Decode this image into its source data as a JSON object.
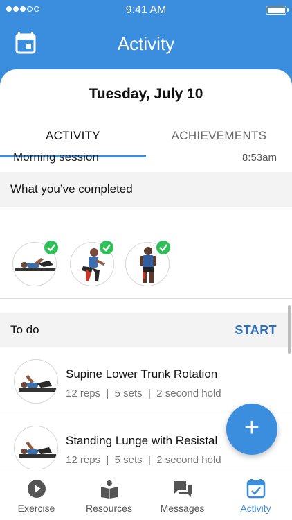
{
  "status_bar": {
    "time": "9:41 AM"
  },
  "header": {
    "title": "Activity",
    "calendar_icon": "calendar-icon"
  },
  "date": "Tuesday, July 10",
  "tabs": [
    {
      "label": "ACTIVITY",
      "active": true
    },
    {
      "label": "ACHIEVEMENTS",
      "active": false
    }
  ],
  "completed": {
    "heading": "What you’ve completed",
    "session": {
      "name": "Morning session",
      "time": "8:53am"
    }
  },
  "todo": {
    "heading": "To do",
    "start_label": "START",
    "items": [
      {
        "title": "Supine Lower Trunk Rotation",
        "reps": "12 reps",
        "sets": "5 sets",
        "hold": "2 second hold"
      },
      {
        "title": "Standing Lunge with Resistal",
        "reps": "12 reps",
        "sets": "5 sets",
        "hold": "2 second hold"
      }
    ]
  },
  "fab": {
    "label": "+"
  },
  "bottom_nav": [
    {
      "label": "Exercise",
      "icon": "play-circle-icon"
    },
    {
      "label": "Resources",
      "icon": "book-icon"
    },
    {
      "label": "Messages",
      "icon": "chat-icon"
    },
    {
      "label": "Activity",
      "icon": "calendar-check-icon",
      "active": true
    }
  ],
  "colors": {
    "primary": "#3b8ede",
    "check": "#2fc05a",
    "start": "#2f6fbf"
  }
}
